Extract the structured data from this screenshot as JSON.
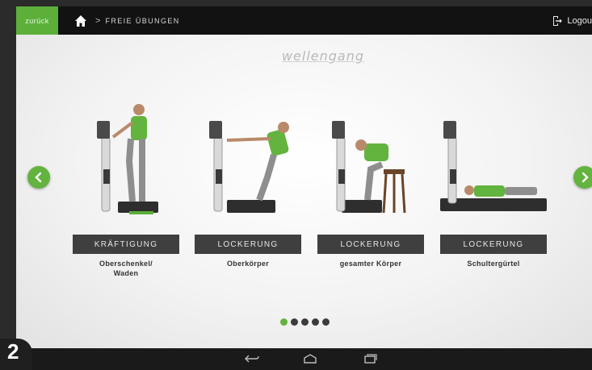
{
  "topbar": {
    "back_label": "zurück",
    "breadcrumb": "FREIE ÜBUNGEN",
    "logout_label": "Logou"
  },
  "brand": {
    "logo_text": "wellengang"
  },
  "exercises": [
    {
      "button": "KRÄFTIGUNG",
      "caption_line1": "Oberschenkel/",
      "caption_line2": "Waden"
    },
    {
      "button": "LOCKERUNG",
      "caption_line1": "Oberkörper",
      "caption_line2": ""
    },
    {
      "button": "LOCKERUNG",
      "caption_line1": "gesamter Körper",
      "caption_line2": ""
    },
    {
      "button": "LOCKERUNG",
      "caption_line1": "Schultergürtel",
      "caption_line2": ""
    }
  ],
  "pager": {
    "total": 5,
    "active_index": 0
  },
  "badge": {
    "number": "2"
  },
  "colors": {
    "accent_green": "#63b33f",
    "topbar_bg": "#121212",
    "button_bg": "#3f3f3f"
  },
  "icons": [
    "home-icon",
    "chevron-right-icon",
    "logout-icon",
    "arrow-left-icon",
    "arrow-right-icon",
    "back-icon",
    "home-nav-icon",
    "recents-icon"
  ]
}
